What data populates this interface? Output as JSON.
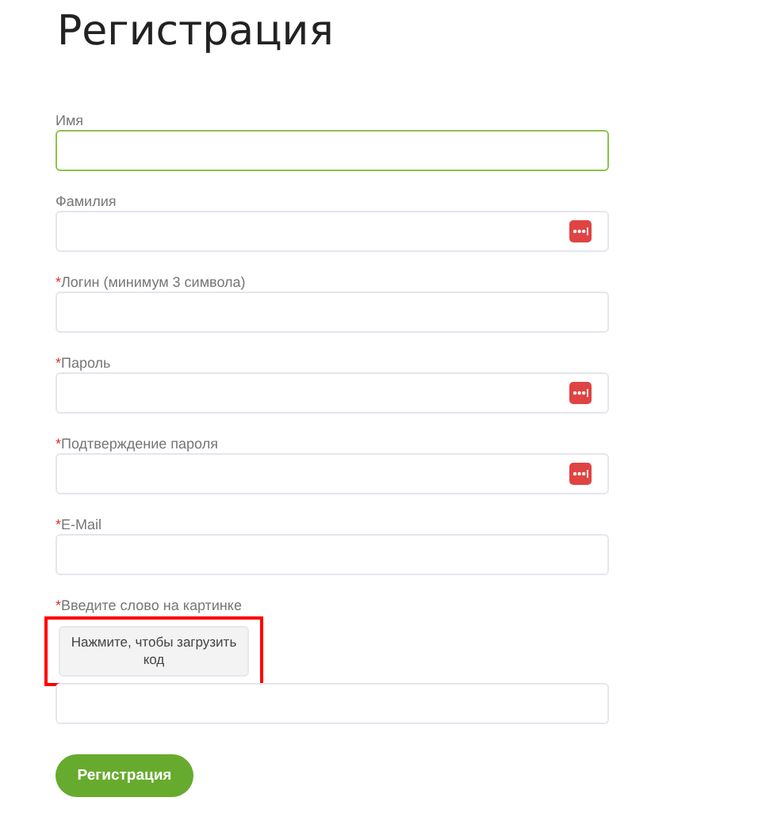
{
  "title": "Регистрация",
  "fields": [
    {
      "label": "Имя",
      "focused": true,
      "autofill_icon": false
    },
    {
      "label": "Фамилия",
      "focused": false,
      "autofill_icon": true
    },
    {
      "label": "Логин (минимум 3 символа)",
      "required_mark": "*",
      "focused": false,
      "autofill_icon": false
    },
    {
      "label": "Пароль",
      "required_mark": "*",
      "focused": false,
      "autofill_icon": true
    },
    {
      "label": "Подтверждение пароля",
      "required_mark": "*",
      "focused": false,
      "autofill_icon": true
    },
    {
      "label": "E-Mail",
      "required_mark": "*",
      "focused": false,
      "autofill_icon": false
    }
  ],
  "captcha": {
    "label": "Введите слово на картинке",
    "required_mark": "*",
    "button": "Нажмите, чтобы загрузить код",
    "highlighted": true
  },
  "submit": "Регистрация"
}
